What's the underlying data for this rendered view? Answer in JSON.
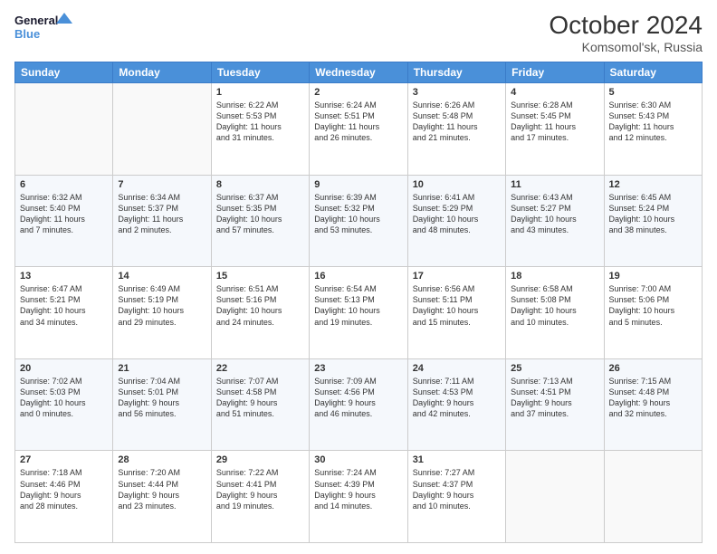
{
  "header": {
    "logo_line1": "General",
    "logo_line2": "Blue",
    "month": "October 2024",
    "location": "Komsomol'sk, Russia"
  },
  "weekdays": [
    "Sunday",
    "Monday",
    "Tuesday",
    "Wednesday",
    "Thursday",
    "Friday",
    "Saturday"
  ],
  "weeks": [
    [
      {
        "day": "",
        "content": ""
      },
      {
        "day": "",
        "content": ""
      },
      {
        "day": "1",
        "content": "Sunrise: 6:22 AM\nSunset: 5:53 PM\nDaylight: 11 hours\nand 31 minutes."
      },
      {
        "day": "2",
        "content": "Sunrise: 6:24 AM\nSunset: 5:51 PM\nDaylight: 11 hours\nand 26 minutes."
      },
      {
        "day": "3",
        "content": "Sunrise: 6:26 AM\nSunset: 5:48 PM\nDaylight: 11 hours\nand 21 minutes."
      },
      {
        "day": "4",
        "content": "Sunrise: 6:28 AM\nSunset: 5:45 PM\nDaylight: 11 hours\nand 17 minutes."
      },
      {
        "day": "5",
        "content": "Sunrise: 6:30 AM\nSunset: 5:43 PM\nDaylight: 11 hours\nand 12 minutes."
      }
    ],
    [
      {
        "day": "6",
        "content": "Sunrise: 6:32 AM\nSunset: 5:40 PM\nDaylight: 11 hours\nand 7 minutes."
      },
      {
        "day": "7",
        "content": "Sunrise: 6:34 AM\nSunset: 5:37 PM\nDaylight: 11 hours\nand 2 minutes."
      },
      {
        "day": "8",
        "content": "Sunrise: 6:37 AM\nSunset: 5:35 PM\nDaylight: 10 hours\nand 57 minutes."
      },
      {
        "day": "9",
        "content": "Sunrise: 6:39 AM\nSunset: 5:32 PM\nDaylight: 10 hours\nand 53 minutes."
      },
      {
        "day": "10",
        "content": "Sunrise: 6:41 AM\nSunset: 5:29 PM\nDaylight: 10 hours\nand 48 minutes."
      },
      {
        "day": "11",
        "content": "Sunrise: 6:43 AM\nSunset: 5:27 PM\nDaylight: 10 hours\nand 43 minutes."
      },
      {
        "day": "12",
        "content": "Sunrise: 6:45 AM\nSunset: 5:24 PM\nDaylight: 10 hours\nand 38 minutes."
      }
    ],
    [
      {
        "day": "13",
        "content": "Sunrise: 6:47 AM\nSunset: 5:21 PM\nDaylight: 10 hours\nand 34 minutes."
      },
      {
        "day": "14",
        "content": "Sunrise: 6:49 AM\nSunset: 5:19 PM\nDaylight: 10 hours\nand 29 minutes."
      },
      {
        "day": "15",
        "content": "Sunrise: 6:51 AM\nSunset: 5:16 PM\nDaylight: 10 hours\nand 24 minutes."
      },
      {
        "day": "16",
        "content": "Sunrise: 6:54 AM\nSunset: 5:13 PM\nDaylight: 10 hours\nand 19 minutes."
      },
      {
        "day": "17",
        "content": "Sunrise: 6:56 AM\nSunset: 5:11 PM\nDaylight: 10 hours\nand 15 minutes."
      },
      {
        "day": "18",
        "content": "Sunrise: 6:58 AM\nSunset: 5:08 PM\nDaylight: 10 hours\nand 10 minutes."
      },
      {
        "day": "19",
        "content": "Sunrise: 7:00 AM\nSunset: 5:06 PM\nDaylight: 10 hours\nand 5 minutes."
      }
    ],
    [
      {
        "day": "20",
        "content": "Sunrise: 7:02 AM\nSunset: 5:03 PM\nDaylight: 10 hours\nand 0 minutes."
      },
      {
        "day": "21",
        "content": "Sunrise: 7:04 AM\nSunset: 5:01 PM\nDaylight: 9 hours\nand 56 minutes."
      },
      {
        "day": "22",
        "content": "Sunrise: 7:07 AM\nSunset: 4:58 PM\nDaylight: 9 hours\nand 51 minutes."
      },
      {
        "day": "23",
        "content": "Sunrise: 7:09 AM\nSunset: 4:56 PM\nDaylight: 9 hours\nand 46 minutes."
      },
      {
        "day": "24",
        "content": "Sunrise: 7:11 AM\nSunset: 4:53 PM\nDaylight: 9 hours\nand 42 minutes."
      },
      {
        "day": "25",
        "content": "Sunrise: 7:13 AM\nSunset: 4:51 PM\nDaylight: 9 hours\nand 37 minutes."
      },
      {
        "day": "26",
        "content": "Sunrise: 7:15 AM\nSunset: 4:48 PM\nDaylight: 9 hours\nand 32 minutes."
      }
    ],
    [
      {
        "day": "27",
        "content": "Sunrise: 7:18 AM\nSunset: 4:46 PM\nDaylight: 9 hours\nand 28 minutes."
      },
      {
        "day": "28",
        "content": "Sunrise: 7:20 AM\nSunset: 4:44 PM\nDaylight: 9 hours\nand 23 minutes."
      },
      {
        "day": "29",
        "content": "Sunrise: 7:22 AM\nSunset: 4:41 PM\nDaylight: 9 hours\nand 19 minutes."
      },
      {
        "day": "30",
        "content": "Sunrise: 7:24 AM\nSunset: 4:39 PM\nDaylight: 9 hours\nand 14 minutes."
      },
      {
        "day": "31",
        "content": "Sunrise: 7:27 AM\nSunset: 4:37 PM\nDaylight: 9 hours\nand 10 minutes."
      },
      {
        "day": "",
        "content": ""
      },
      {
        "day": "",
        "content": ""
      }
    ]
  ]
}
